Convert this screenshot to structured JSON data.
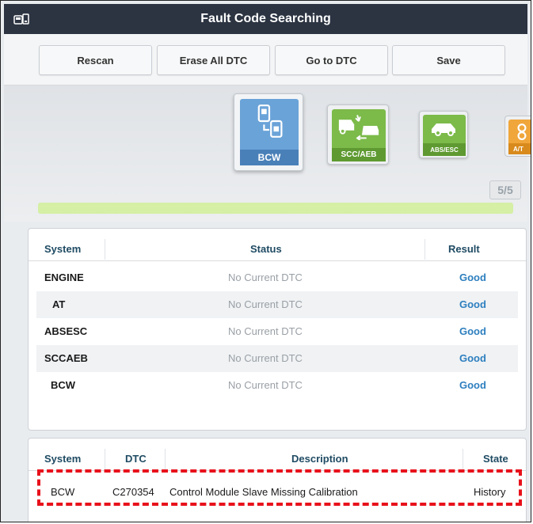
{
  "window": {
    "title": "Fault Code Searching",
    "icon": "car-scan-icon"
  },
  "toolbar": {
    "rescan": "Rescan",
    "erase_all": "Erase All DTC",
    "go_to_dtc": "Go to DTC",
    "save": "Save"
  },
  "carousel": {
    "tiles": [
      {
        "label": "BCW",
        "icon": "bcw-modules-icon",
        "selected": true
      },
      {
        "label": "SCC/AEB",
        "icon": "collision-avoid-icon",
        "selected": false
      },
      {
        "label": "ABS/ESC",
        "icon": "car-brake-icon",
        "selected": false
      },
      {
        "label": "A/T",
        "icon": "gearbox-icon",
        "selected": false
      }
    ],
    "page": "5/5",
    "progress": 1.0
  },
  "status_table": {
    "headers": {
      "system": "System",
      "status": "Status",
      "result": "Result"
    },
    "rows": [
      {
        "system": "ENGINE",
        "status": "No Current DTC",
        "result": "Good"
      },
      {
        "system": "AT",
        "status": "No Current DTC",
        "result": "Good"
      },
      {
        "system": "ABSESC",
        "status": "No Current DTC",
        "result": "Good"
      },
      {
        "system": "SCCAEB",
        "status": "No Current DTC",
        "result": "Good"
      },
      {
        "system": "BCW",
        "status": "No Current DTC",
        "result": "Good"
      }
    ]
  },
  "dtc_table": {
    "headers": {
      "system": "System",
      "dtc": "DTC",
      "description": "Description",
      "state": "State"
    },
    "rows": [
      {
        "system": "BCW",
        "dtc": "C270354",
        "description": "Control Module Slave Missing Calibration",
        "state": "History"
      }
    ]
  },
  "colors": {
    "titlebar": "#2c3442",
    "accent_green": "#7ab648",
    "result_good": "#2d7fbf",
    "header_text": "#1f4b63",
    "highlight": "#e8111b"
  }
}
